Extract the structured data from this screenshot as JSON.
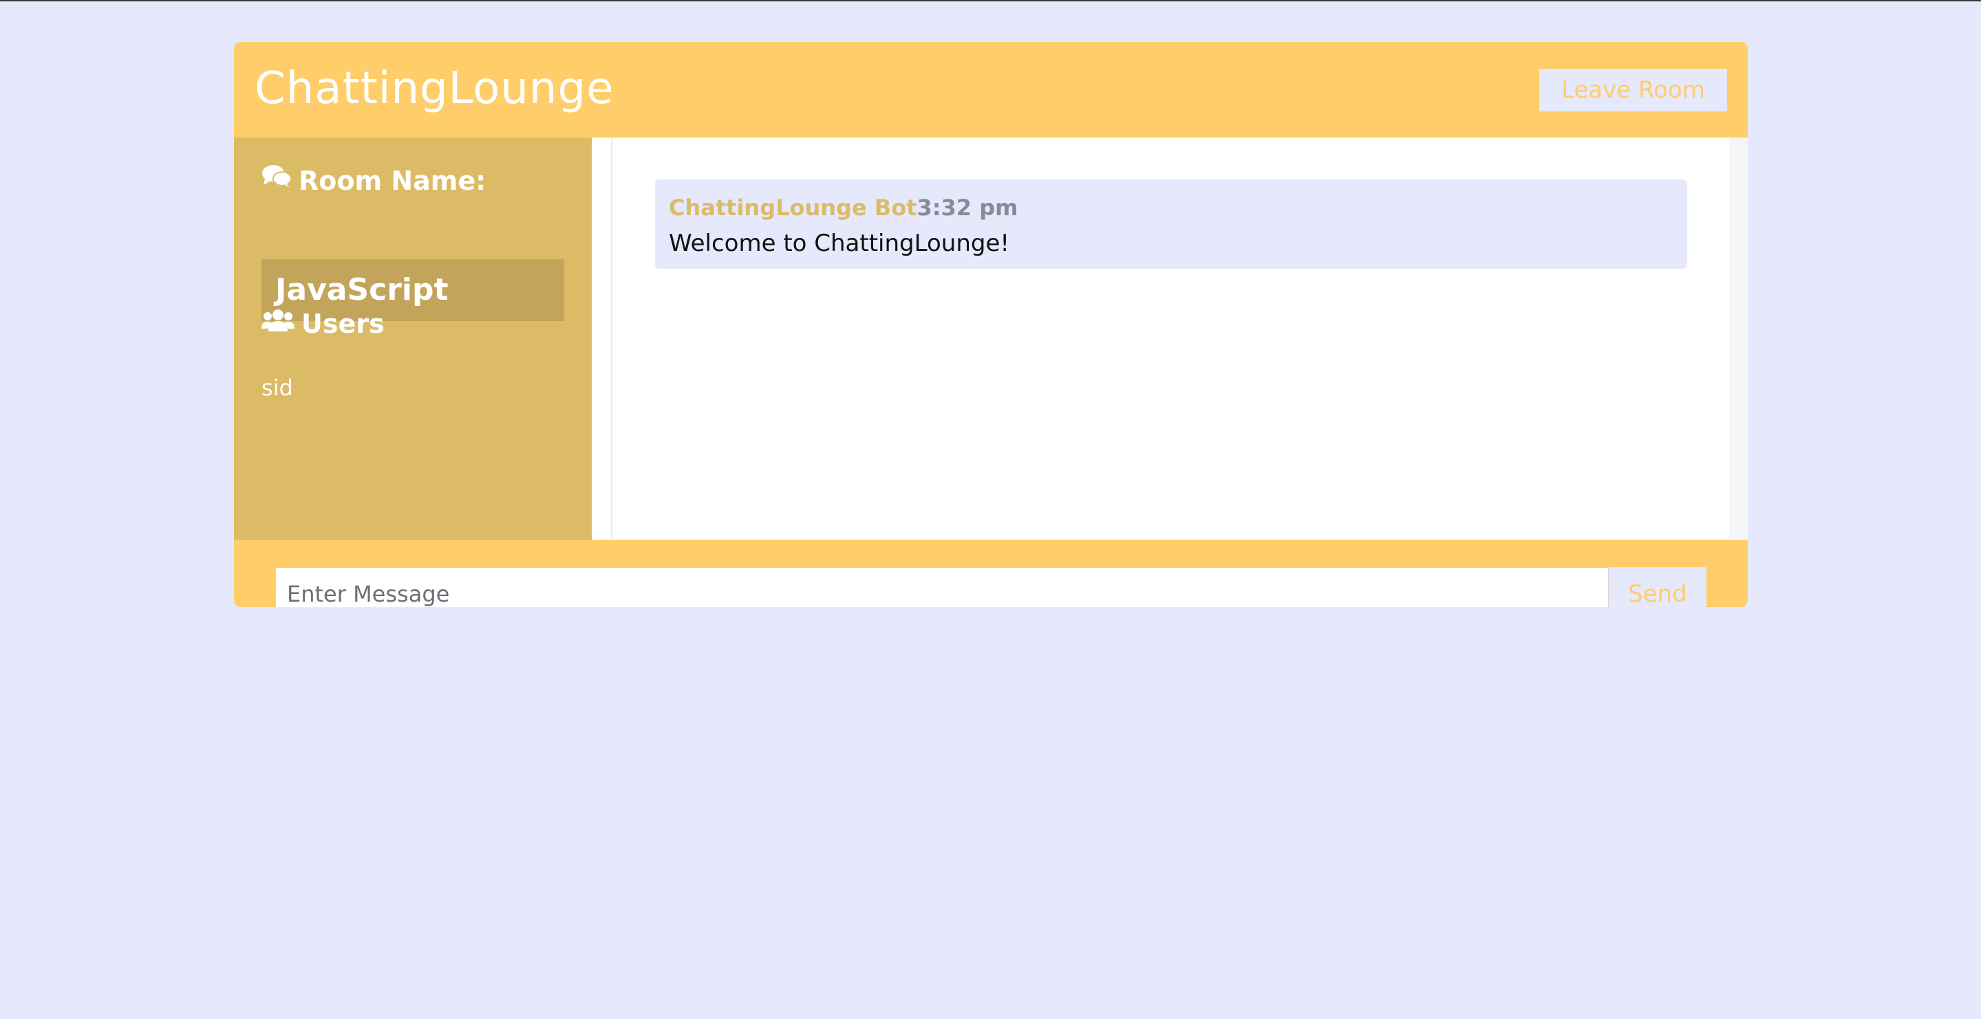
{
  "app": {
    "title": "ChattingLounge",
    "leave_label": "Leave Room"
  },
  "sidebar": {
    "room_heading": "Room Name:",
    "room_name": "JavaScript",
    "users_heading": "Users",
    "users": [
      "sid"
    ]
  },
  "messages": [
    {
      "sender": "ChattingLounge Bot",
      "time": "3:32 pm",
      "text": "Welcome to ChattingLounge!"
    }
  ],
  "form": {
    "placeholder": "Enter Message",
    "send_label": "Send"
  },
  "icons": {
    "room": "comments-icon",
    "users": "users-icon"
  },
  "colors": {
    "background": "#e6e8fc",
    "primary": "#ffcd69",
    "sidebar": "#dbbb65",
    "room_box": "#c2a55a",
    "message_bg": "#e6e8fc",
    "timestamp": "#8a8a96"
  }
}
